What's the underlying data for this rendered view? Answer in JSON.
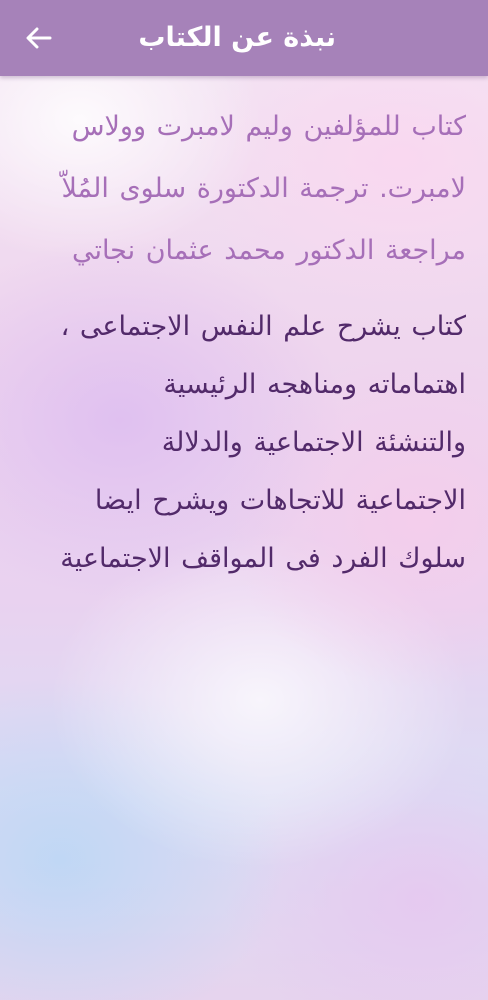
{
  "app_bar": {
    "title": "نبذة عن الكتاب",
    "back_icon": "arrow-left-icon",
    "background_color": "#a682b9"
  },
  "content": {
    "intro_lines": [
      "كتاب للمؤلفين وليم لامبرت وولاس",
      "لامبرت. ترجمة الدكتورة سلوى المُلاّ",
      "مراجعة الدكتور محمد عثمان نجاتي"
    ],
    "description_lines": [
      "كتاب يشرح علم النفس الاجتماعى ،",
      "اهتماماته ومناهجه الرئيسية",
      "والتنشئة الاجتماعية والدلالة",
      "الاجتماعية للاتجاهات ويشرح ايضا",
      "سلوك الفرد فى المواقف الاجتماعية"
    ],
    "intro_color": "#a66fb8",
    "description_color": "#522a6a"
  }
}
